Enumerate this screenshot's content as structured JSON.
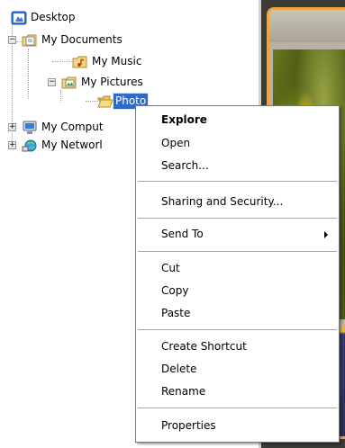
{
  "tree": {
    "items": [
      {
        "label": "Desktop",
        "icon": "desktop-icon"
      },
      {
        "label": "My Documents",
        "icon": "documents-folder-icon",
        "expander": "−"
      },
      {
        "label": "My Music",
        "icon": "music-folder-icon"
      },
      {
        "label": "My Pictures",
        "icon": "pictures-folder-icon",
        "expander": "−"
      },
      {
        "label": "Photo",
        "icon": "open-folder-icon",
        "selected": true
      },
      {
        "label": "My Comput",
        "icon": "computer-icon",
        "expander": "+"
      },
      {
        "label": "My Networl",
        "icon": "network-places-icon",
        "expander": "+"
      }
    ]
  },
  "context_menu": {
    "items": [
      {
        "label": "Explore",
        "default": true
      },
      {
        "label": "Open"
      },
      {
        "label": "Search..."
      },
      {
        "label": "Sharing and Security..."
      },
      {
        "label": "Send To",
        "submenu": true
      },
      {
        "label": "Cut"
      },
      {
        "label": "Copy"
      },
      {
        "label": "Paste"
      },
      {
        "label": "Create Shortcut"
      },
      {
        "label": "Delete"
      },
      {
        "label": "Rename"
      },
      {
        "label": "Properties"
      }
    ]
  },
  "colors": {
    "selection": "#316ac5",
    "photo_frame": "#f0a640",
    "menu_border": "#7a7a7a"
  }
}
